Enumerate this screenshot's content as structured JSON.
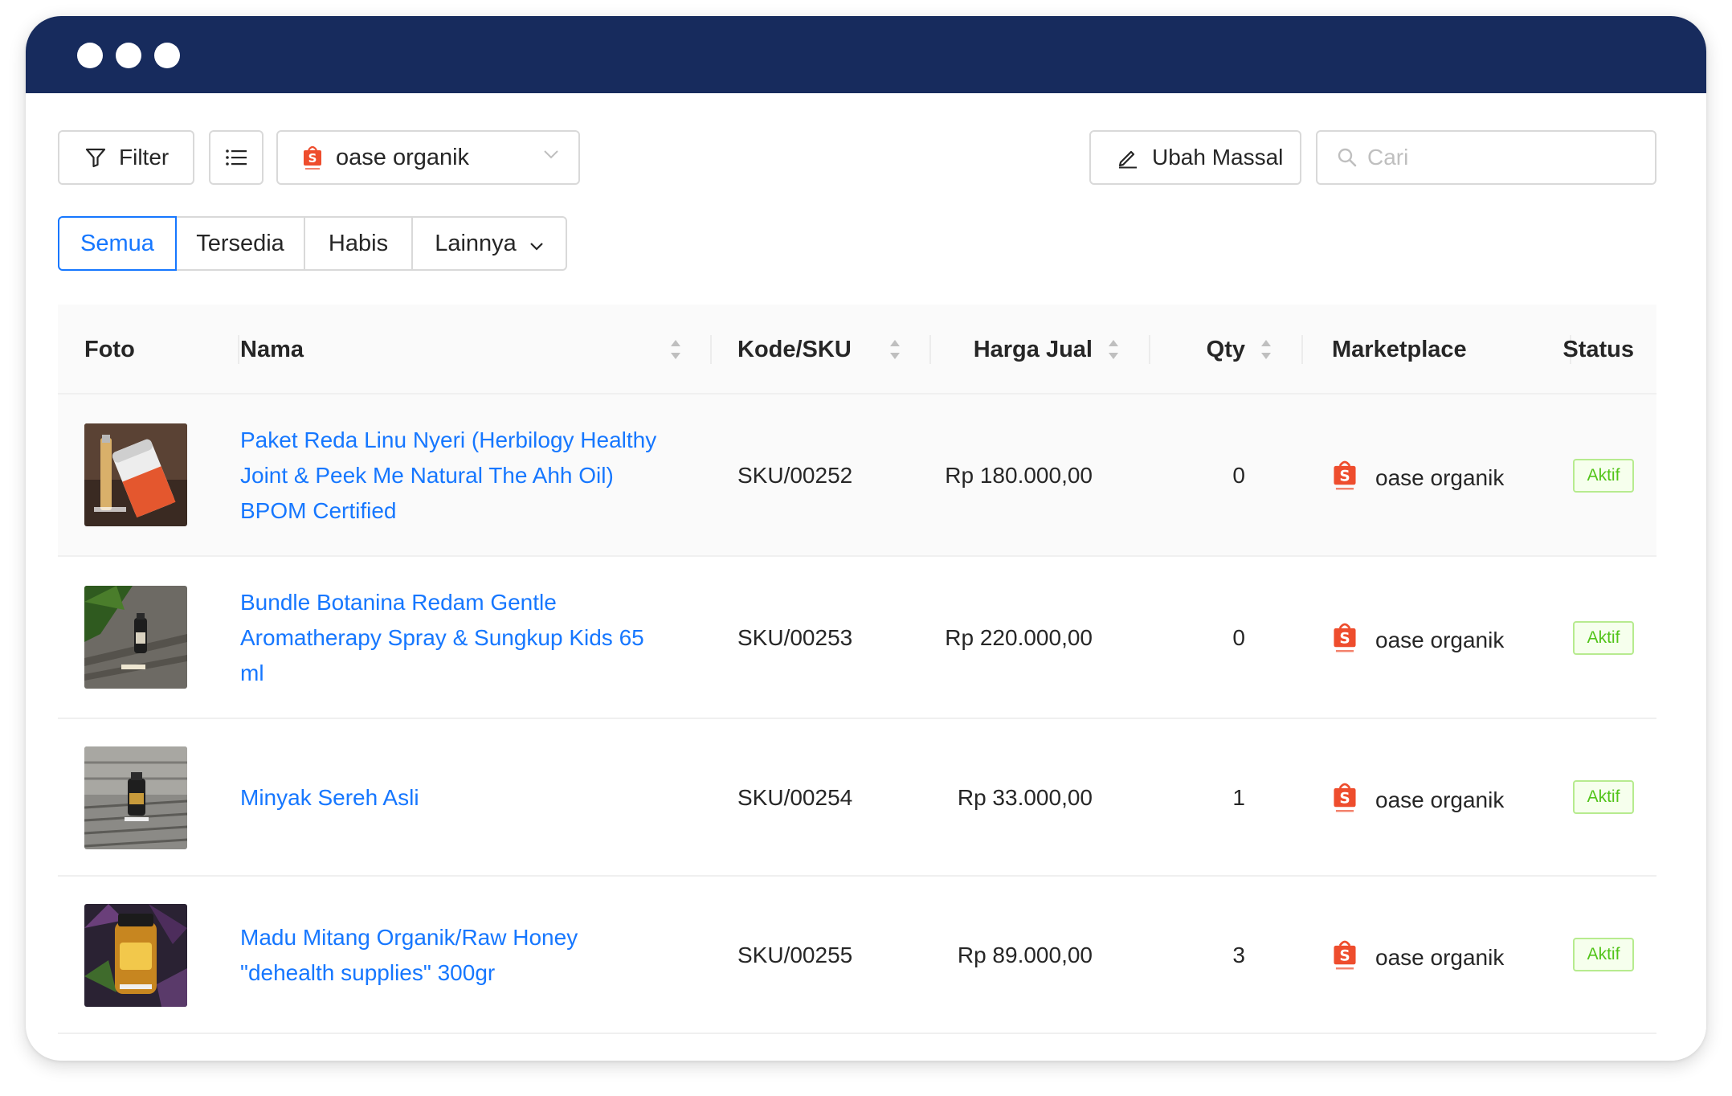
{
  "toolbar": {
    "filter_label": "Filter",
    "store_select_value": "oase organik",
    "mass_edit_label": "Ubah Massal",
    "search_placeholder": "Cari"
  },
  "tabs": [
    {
      "label": "Semua",
      "active": true
    },
    {
      "label": "Tersedia",
      "active": false
    },
    {
      "label": "Habis",
      "active": false
    },
    {
      "label": "Lainnya",
      "active": false
    }
  ],
  "table": {
    "columns": [
      "Foto",
      "Nama",
      "Kode/SKU",
      "Harga Jual",
      "Qty",
      "Marketplace",
      "Status"
    ],
    "rows": [
      {
        "name_lines": [
          "Paket Reda Linu Nyeri (Herbilogy Healthy",
          "Joint & Peek Me Natural The Ahh Oil)",
          "BPOM Certified"
        ],
        "sku": "SKU/00252",
        "price": "Rp 180.000,00",
        "qty": "0",
        "marketplace": "oase organik",
        "status": "Aktif"
      },
      {
        "name_lines": [
          "Bundle Botanina Redam Gentle",
          "Aromatherapy Spray & Sungkup Kids 65",
          "ml"
        ],
        "sku": "SKU/00253",
        "price": "Rp 220.000,00",
        "qty": "0",
        "marketplace": "oase organik",
        "status": "Aktif"
      },
      {
        "name_lines": [
          "Minyak Sereh Asli"
        ],
        "sku": "SKU/00254",
        "price": "Rp 33.000,00",
        "qty": "1",
        "marketplace": "oase organik",
        "status": "Aktif"
      },
      {
        "name_lines": [
          "Madu Mitang Organik/Raw Honey",
          "\"dehealth supplies\" 300gr"
        ],
        "sku": "SKU/00255",
        "price": "Rp 89.000,00",
        "qty": "3",
        "marketplace": "oase organik",
        "status": "Aktif"
      }
    ]
  },
  "colors": {
    "titlebar": "#172b5d",
    "link": "#1677ff",
    "shopee": "#ee4d2d",
    "status_green": "#52c41a"
  },
  "icons": [
    "filter-icon",
    "list-icon",
    "shopee-icon",
    "chevron-down-icon",
    "edit-icon",
    "search-icon",
    "sort-icon"
  ]
}
